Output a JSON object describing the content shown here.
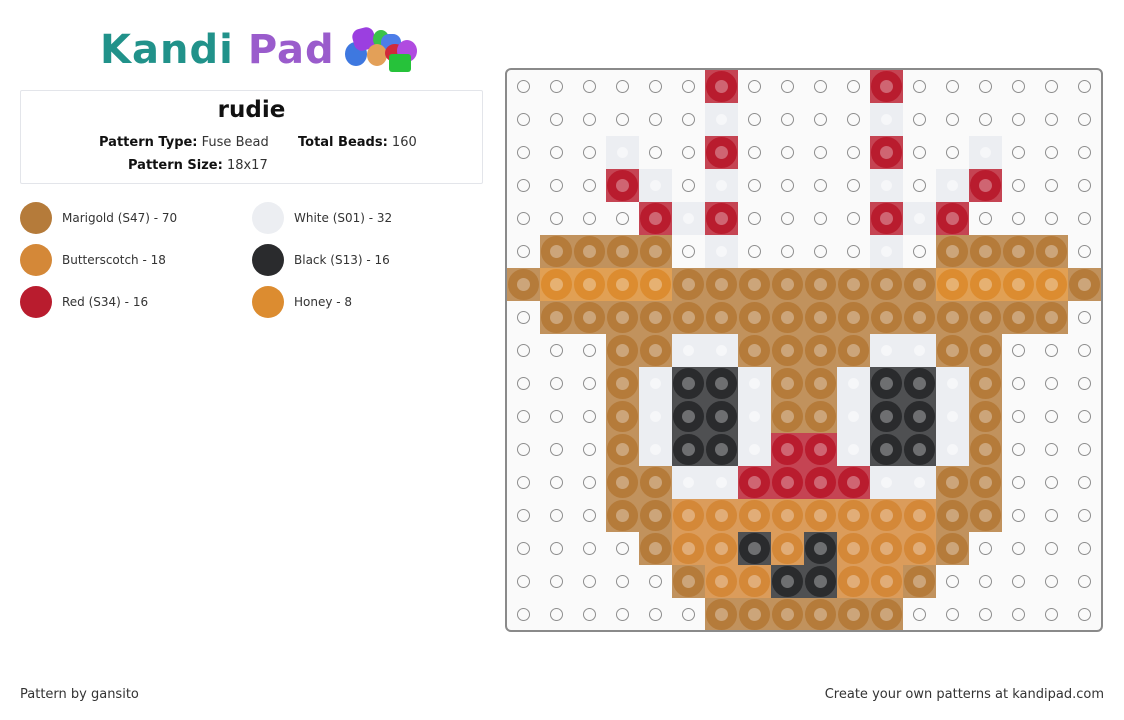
{
  "logo": {
    "part1": "Kandi",
    "part2": "Pad",
    "alt": "Kandi Pad"
  },
  "pattern": {
    "title": "rudie",
    "type_label": "Pattern Type:",
    "type_value": "Fuse Bead",
    "total_label": "Total Beads:",
    "total_value": "160",
    "size_label": "Pattern Size:",
    "size_value": "18x17"
  },
  "legend": [
    {
      "key": "M",
      "label": "Marigold (S47) - 70",
      "color": "#b57b3a"
    },
    {
      "key": "W",
      "label": "White (S01) - 32",
      "color": "#eceef2"
    },
    {
      "key": "B",
      "label": "Butterscotch - 18",
      "color": "#d48838"
    },
    {
      "key": "K",
      "label": "Black (S13) - 16",
      "color": "#2a2b2d"
    },
    {
      "key": "R",
      "label": "Red (S34) - 16",
      "color": "#b91c2e"
    },
    {
      "key": "H",
      "label": "Honey - 8",
      "color": "#dc8c30"
    }
  ],
  "grid": {
    "columns": 18,
    "rows": 17,
    "cells": [
      "......R....R......",
      "......W....W......",
      "...W..R....R..W...",
      "...RW.W....W.WR...",
      "....RWR....RWR....",
      ".MMMM.W....W.MMMM.",
      "MHHHHMMMMMMMMHHHHM",
      ".MMMMMMMMMMMMMMMM.",
      "...MMWWMMMMWWMM...",
      "...MWKKWMMWKKWM...",
      "...MWKKWMMWKKWM...",
      "...MWKKWRRWKKWM...",
      "...MMWWRRRRWWMM...",
      "...MMBBBBBBBBMM...",
      "....MBBKBKBBBM....",
      ".....MBBKKBBM.....",
      "......MMMMMM......"
    ]
  },
  "footer": {
    "credit": "Pattern by gansito",
    "promo": "Create your own patterns at kandipad.com"
  }
}
